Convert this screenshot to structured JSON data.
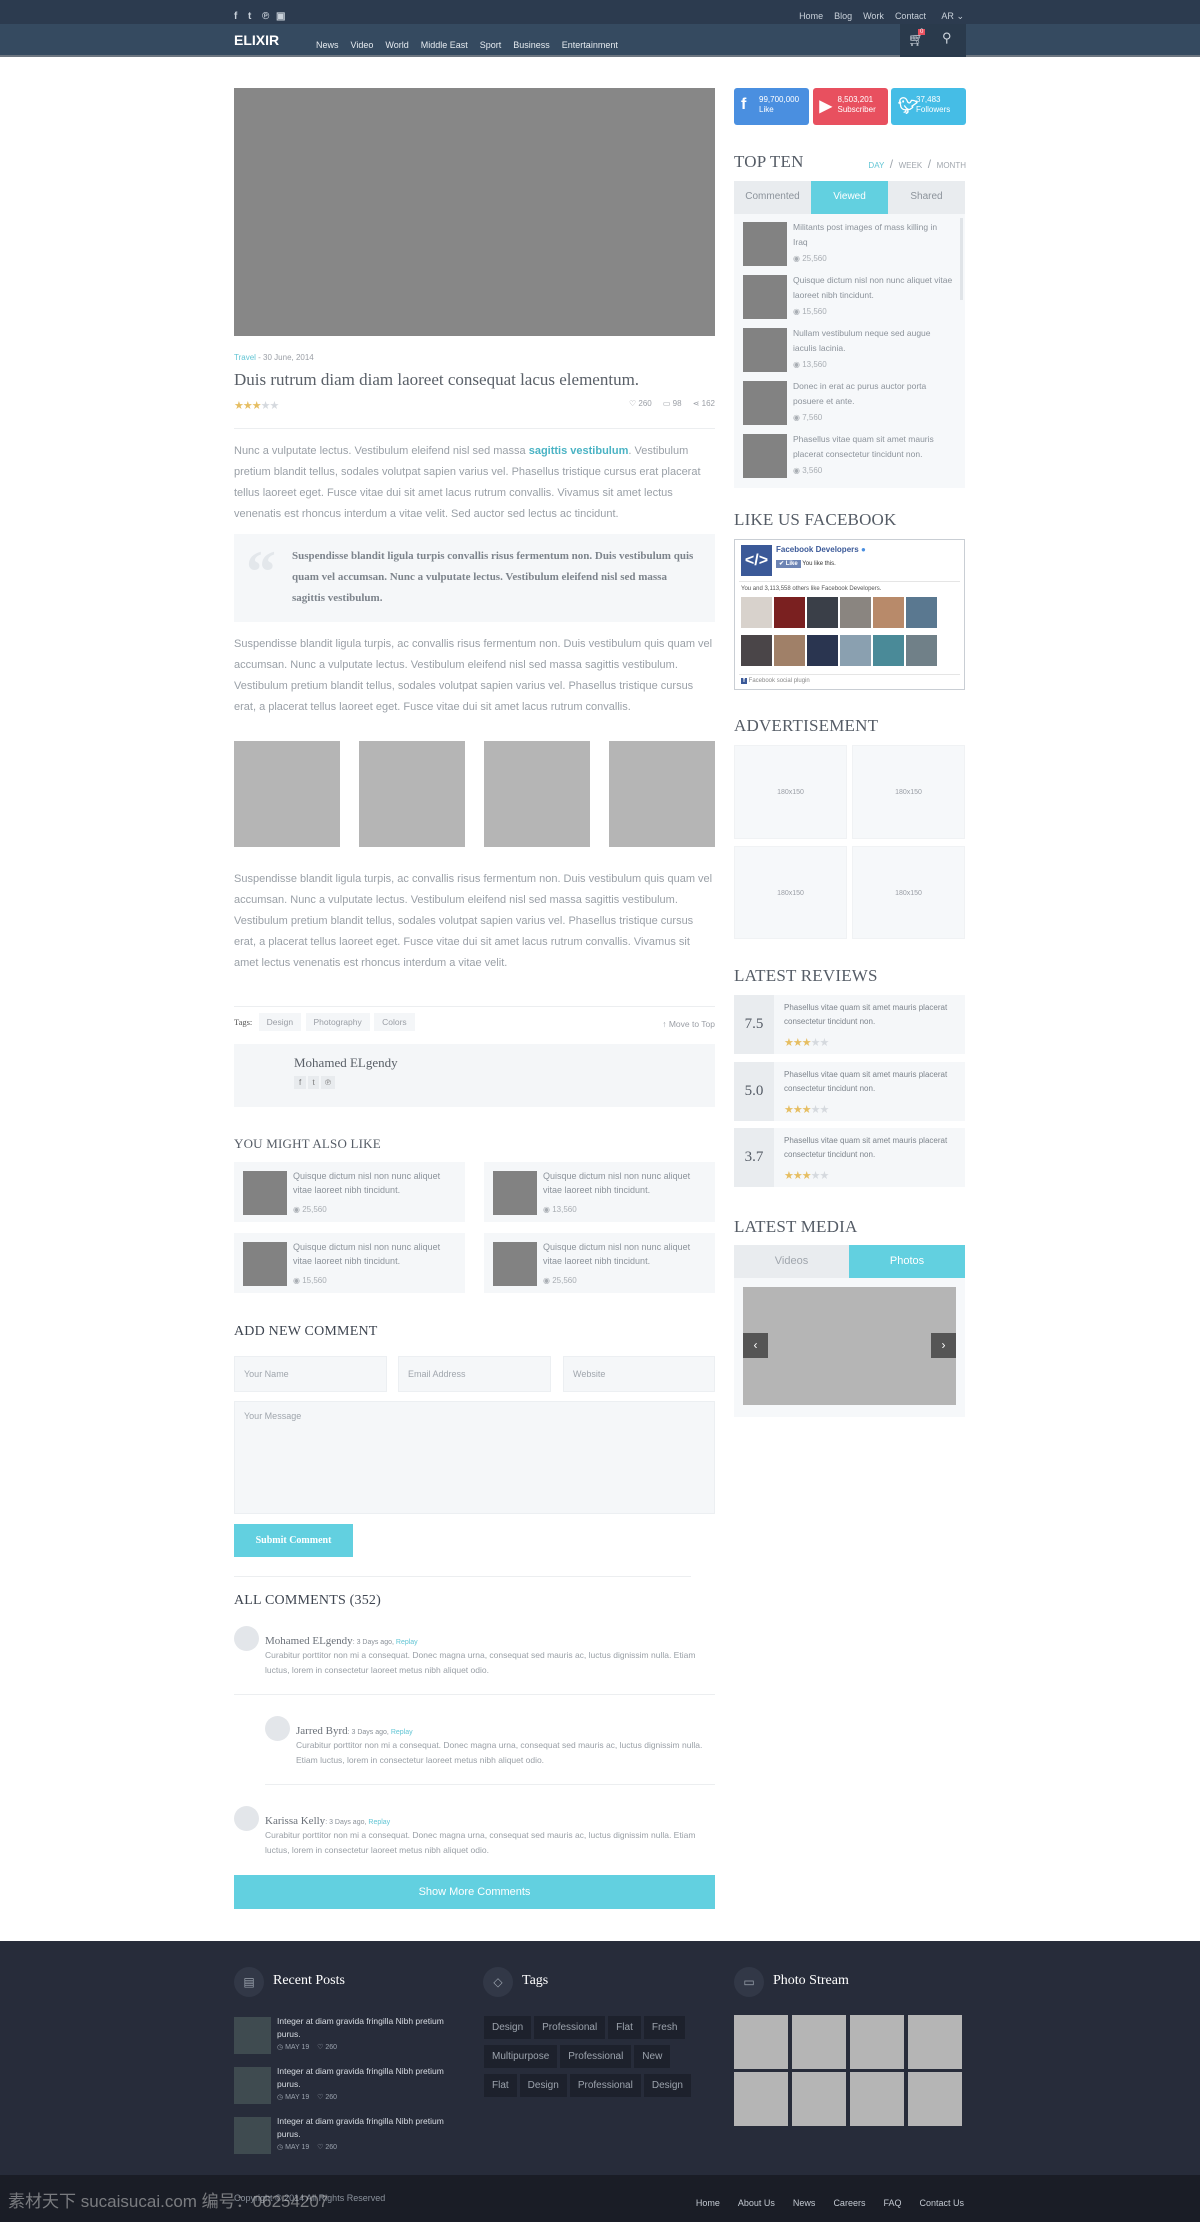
{
  "topbar": {
    "social": [
      "f",
      "t",
      "p",
      "yt"
    ],
    "links": [
      "Home",
      "Blog",
      "Work",
      "Contact"
    ],
    "language": "AR"
  },
  "nav": {
    "logo": "ELIXIR",
    "items": [
      "News",
      "Video",
      "World",
      "Middle East",
      "Sport",
      "Business",
      "Entertainment"
    ],
    "cart_count": "0"
  },
  "article": {
    "category": "Travel",
    "date": " - 30 June, 2014",
    "title": "Duis rutrum diam diam laoreet consequat lacus elementum.",
    "rating": 3,
    "rating_max": 5,
    "likes": "260",
    "comments": "98",
    "shares": "162",
    "p1_start": "Nunc a vulputate lectus. Vestibulum eleifend nisl sed massa ",
    "p1_link": "sagittis vestibulum",
    "p1_end": ". Vestibulum pretium blandit tellus, sodales volutpat sapien varius vel. Phasellus tristique cursus erat placerat tellus laoreet eget. Fusce vitae dui sit amet lacus rutrum convallis. Vivamus sit amet lectus venenatis est rhoncus interdum a vitae velit. Sed auctor sed lectus ac tincidunt.",
    "quote": "Suspendisse blandit ligula turpis convallis risus fermentum non. Duis vestibulum quis quam vel accumsan. Nunc a vulputate lectus. Vestibulum eleifend nisl sed massa sagittis vestibulum.",
    "p2": "Suspendisse blandit ligula turpis, ac convallis risus fermentum non. Duis vestibulum quis quam vel accumsan. Nunc a vulputate lectus. Vestibulum eleifend nisl sed massa sagittis vestibulum. Vestibulum pretium blandit tellus, sodales volutpat sapien varius vel. Phasellus tristique cursus erat, a placerat tellus laoreet eget. Fusce vitae dui sit amet lacus rutrum convallis.",
    "p3": "Suspendisse blandit ligula turpis, ac convallis risus fermentum non. Duis vestibulum quis quam vel accumsan. Nunc a vulputate lectus. Vestibulum eleifend nisl sed massa sagittis vestibulum. Vestibulum pretium blandit tellus, sodales volutpat sapien varius vel. Phasellus tristique cursus erat, a placerat tellus laoreet eget. Fusce vitae dui sit amet lacus rutrum convallis. Vivamus sit amet lectus venenatis est rhoncus interdum a vitae velit.",
    "tags_label": "Tags:",
    "tags": [
      "Design",
      "Photography",
      "Colors"
    ],
    "move_top": "Move to Top",
    "author": "Mohamed ELgendy"
  },
  "related": {
    "title": "YOU MIGHT ALSO LIKE",
    "items": [
      {
        "text": "Quisque dictum nisl non nunc aliquet vitae laoreet nibh tincidunt.",
        "views": "25,560"
      },
      {
        "text": "Quisque dictum nisl non nunc aliquet vitae laoreet nibh tincidunt.",
        "views": "13,560"
      },
      {
        "text": "Quisque dictum nisl non nunc aliquet vitae laoreet nibh tincidunt.",
        "views": "15,560"
      },
      {
        "text": "Quisque dictum nisl non nunc aliquet vitae laoreet nibh tincidunt.",
        "views": "25,560"
      }
    ]
  },
  "comment_form": {
    "title": "ADD NEW COMMENT",
    "name": "Your Name",
    "email": "Email Address",
    "website": "Website",
    "message": "Your Message",
    "submit": "Submit Comment"
  },
  "comments": {
    "title": "ALL COMMENTS (352)",
    "items": [
      {
        "name": "Mohamed ELgendy",
        "meta": ": 3 Days ago, ",
        "reply": "Replay",
        "text": "Curabitur porttitor non mi a consequat. Donec magna urna, consequat sed mauris ac, luctus dignissim nulla. Etiam luctus, lorem in consectetur laoreet metus nibh aliquet odio."
      },
      {
        "name": "Jarred Byrd",
        "meta": ": 3 Days ago, ",
        "reply": "Replay",
        "text": "Curabitur porttitor non mi a consequat. Donec magna urna, consequat sed mauris ac, luctus dignissim nulla. Etiam luctus, lorem in consectetur laoreet metus nibh aliquet odio."
      },
      {
        "name": "Karissa Kelly",
        "meta": ": 3 Days ago, ",
        "reply": "Replay",
        "text": "Curabitur porttitor non mi a consequat. Donec magna urna, consequat sed mauris ac, luctus dignissim nulla. Etiam luctus, lorem in consectetur laoreet metus nibh aliquet odio."
      }
    ],
    "more": "Show More Comments"
  },
  "social_counts": [
    {
      "count": "99,700,000",
      "label": "Like",
      "color": "#4a8fe0"
    },
    {
      "count": "8,503,201",
      "label": "Subscriber",
      "color": "#e8505f"
    },
    {
      "count": "37,483",
      "label": "Followers",
      "color": "#45bde6"
    }
  ],
  "topten": {
    "title": "TOP TEN",
    "periods": [
      "DAY",
      "WEEK",
      "MONTH"
    ],
    "tabs": [
      "Commented",
      "Viewed",
      "Shared"
    ],
    "items": [
      {
        "text": "Militants post images of mass killing in Iraq",
        "views": "25,560"
      },
      {
        "text": "Quisque dictum nisl non nunc aliquet vitae laoreet nibh tincidunt.",
        "views": "15,560"
      },
      {
        "text": "Nullam vestibulum neque sed augue iaculis lacinia.",
        "views": "13,560"
      },
      {
        "text": "Donec in erat ac purus auctor porta posuere et ante.",
        "views": "7,560"
      },
      {
        "text": "Phasellus vitae quam sit amet mauris placerat consectetur tincidunt non.",
        "views": "3,560"
      }
    ]
  },
  "facebook": {
    "title": "LIKE US FACEBOOK",
    "page": "Facebook Developers",
    "like": "Like",
    "you_like": "You like this.",
    "others": "You and 3,113,558 others like Facebook Developers.",
    "plugin": "Facebook social plugin"
  },
  "ads": {
    "title": "ADVERTISEMENT",
    "slots": [
      "180x150",
      "180x150",
      "180x150",
      "180x150"
    ]
  },
  "reviews": {
    "title": "LATEST REVIEWS",
    "items": [
      {
        "score": "7.5",
        "text": "Phasellus vitae quam sit amet mauris placerat consectetur tincidunt non.",
        "stars": 3
      },
      {
        "score": "5.0",
        "text": "Phasellus vitae quam sit amet mauris placerat consectetur tincidunt non.",
        "stars": 3
      },
      {
        "score": "3.7",
        "text": "Phasellus vitae quam sit amet mauris placerat consectetur tincidunt non.",
        "stars": 3
      }
    ]
  },
  "media": {
    "title": "LATEST MEDIA",
    "tabs": [
      "Videos",
      "Photos"
    ]
  },
  "footer": {
    "recent_title": "Recent Posts",
    "posts": [
      {
        "text": "Integer at diam gravida fringilla Nibh pretium purus.",
        "date": "MAY 19",
        "likes": "260"
      },
      {
        "text": "Integer at diam gravida fringilla Nibh pretium purus.",
        "date": "MAY 19",
        "likes": "260"
      },
      {
        "text": "Integer at diam gravida fringilla Nibh pretium purus.",
        "date": "MAY 19",
        "likes": "260"
      }
    ],
    "tags_title": "Tags",
    "tags": [
      "Design",
      "Professional",
      "Flat",
      "Fresh",
      "Multipurpose",
      "Professional",
      "New",
      "Flat",
      "Design",
      "Professional",
      "Design"
    ],
    "photo_title": "Photo Stream",
    "copyright": "Copyright © 2014 All Rights Reserved",
    "links": [
      "Home",
      "About Us",
      "News",
      "Careers",
      "FAQ",
      "Contact Us"
    ],
    "watermark": "素材天下 sucaisucai.com  编号：06254207"
  },
  "colors": {
    "accent": "#62d0e0",
    "topbar": "#2c3b4f",
    "nav": "#354a60",
    "footer": "#272c3a",
    "footer_bottom": "#1a1d26",
    "star": "#e6be62"
  }
}
